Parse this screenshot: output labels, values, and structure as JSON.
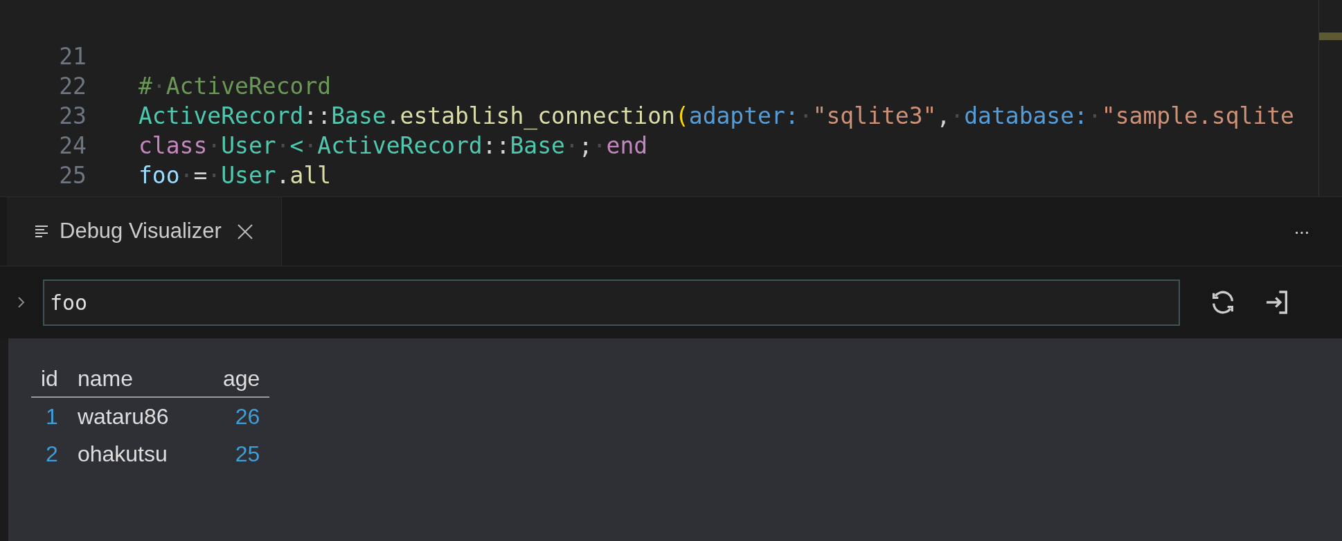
{
  "editor": {
    "lines": [
      {
        "number": "21"
      },
      {
        "number": "22",
        "tokens": [
          {
            "kind": "comment",
            "text": "#"
          },
          {
            "kind": "space",
            "text": "·"
          },
          {
            "kind": "comment",
            "text": "ActiveRecord"
          }
        ]
      },
      {
        "number": "23",
        "tokens": [
          {
            "kind": "class",
            "text": "ActiveRecord"
          },
          {
            "kind": "plain",
            "text": "::"
          },
          {
            "kind": "class",
            "text": "Base"
          },
          {
            "kind": "plain",
            "text": "."
          },
          {
            "kind": "method",
            "text": "establish_connection"
          },
          {
            "kind": "paren",
            "text": "("
          },
          {
            "kind": "symbol",
            "text": "adapter:"
          },
          {
            "kind": "space",
            "text": "·"
          },
          {
            "kind": "string",
            "text": "\"sqlite3\""
          },
          {
            "kind": "plain",
            "text": ","
          },
          {
            "kind": "space",
            "text": "·"
          },
          {
            "kind": "symbol",
            "text": "database:"
          },
          {
            "kind": "space",
            "text": "·"
          },
          {
            "kind": "string",
            "text": "\"sample.sqlite"
          }
        ]
      },
      {
        "number": "24",
        "tokens": [
          {
            "kind": "keyword",
            "text": "class"
          },
          {
            "kind": "space",
            "text": "·"
          },
          {
            "kind": "class",
            "text": "User"
          },
          {
            "kind": "space",
            "text": "·"
          },
          {
            "kind": "class",
            "text": "<"
          },
          {
            "kind": "space",
            "text": "·"
          },
          {
            "kind": "class",
            "text": "ActiveRecord"
          },
          {
            "kind": "plain",
            "text": "::"
          },
          {
            "kind": "class",
            "text": "Base"
          },
          {
            "kind": "space",
            "text": "·"
          },
          {
            "kind": "plain",
            "text": ";"
          },
          {
            "kind": "space",
            "text": "·"
          },
          {
            "kind": "keyword",
            "text": "end"
          }
        ]
      },
      {
        "number": "25",
        "tokens": [
          {
            "kind": "variable",
            "text": "foo"
          },
          {
            "kind": "space",
            "text": "·"
          },
          {
            "kind": "plain",
            "text": "="
          },
          {
            "kind": "space",
            "text": "·"
          },
          {
            "kind": "class",
            "text": "User"
          },
          {
            "kind": "plain",
            "text": "."
          },
          {
            "kind": "method",
            "text": "all"
          }
        ]
      }
    ]
  },
  "panel": {
    "tabs": [
      {
        "label": "Debug Visualizer",
        "selected": true
      }
    ],
    "more": "···"
  },
  "expression": {
    "value": "foo",
    "expanded": false
  },
  "table": {
    "columns": [
      "id",
      "name",
      "age"
    ],
    "rows": [
      [
        {
          "kind": "number",
          "text": "1"
        },
        {
          "kind": "text",
          "text": "wataru86"
        },
        {
          "kind": "number",
          "text": "26"
        }
      ],
      [
        {
          "kind": "number",
          "text": "2"
        },
        {
          "kind": "text",
          "text": "ohakutsu"
        },
        {
          "kind": "number",
          "text": "25"
        }
      ]
    ]
  }
}
